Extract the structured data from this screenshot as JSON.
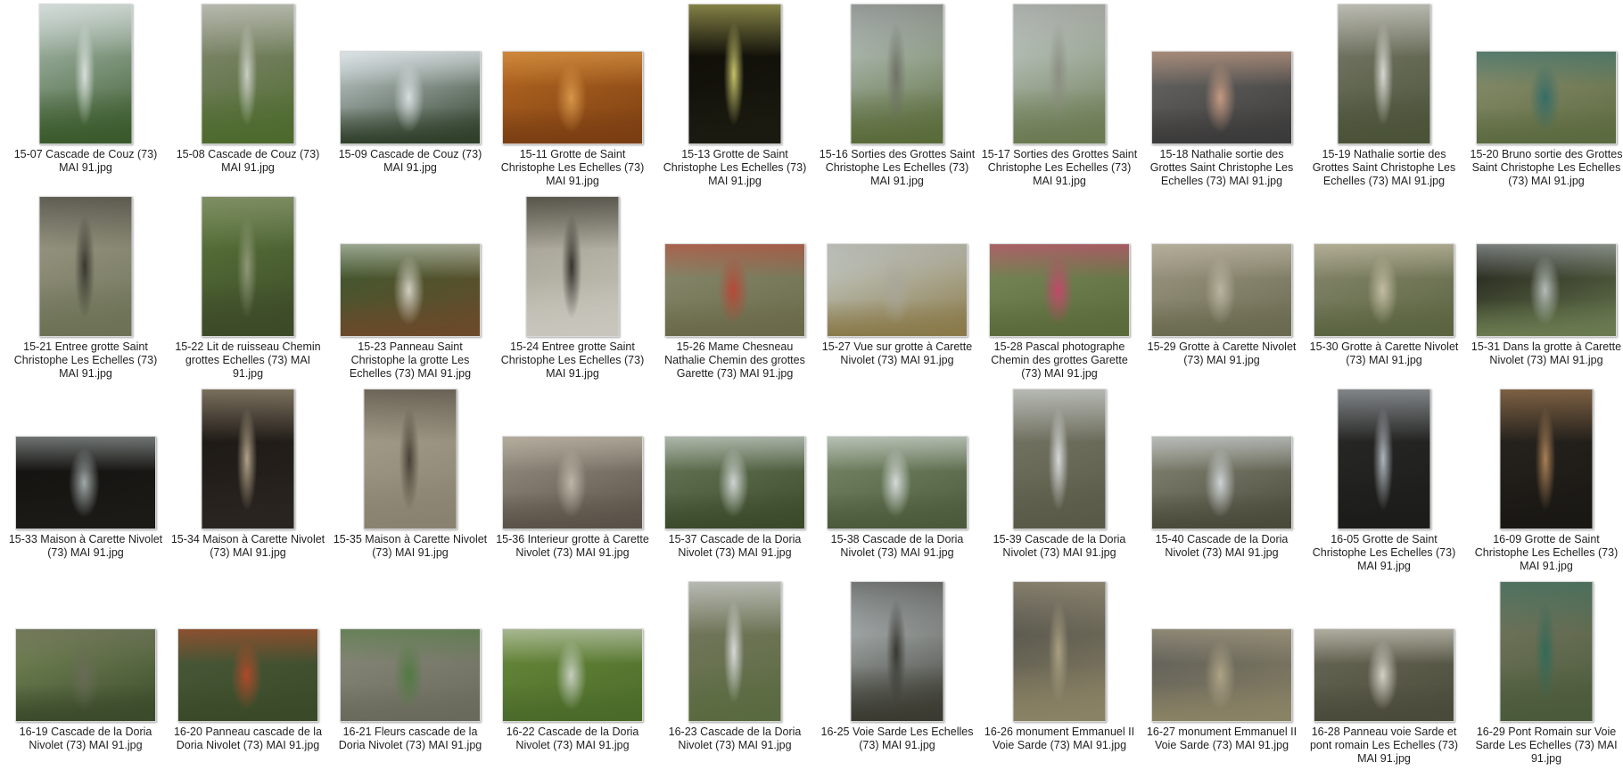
{
  "files": [
    {
      "name": "15-07 Cascade de Couz (73) MAI 91.jpg",
      "orientation": "portrait",
      "colors": [
        "#b7c6bf",
        "#3a5a2c",
        "#e8ecec"
      ]
    },
    {
      "name": "15-08 Cascade de Couz (73) MAI 91.jpg",
      "orientation": "portrait",
      "colors": [
        "#8a8c7a",
        "#4d6a2e",
        "#d9dcd6"
      ]
    },
    {
      "name": "15-09 Cascade de Couz (73) MAI 91.jpg",
      "orientation": "landscape",
      "colors": [
        "#c9d3d6",
        "#2f3f2a",
        "#e6ecef"
      ]
    },
    {
      "name": "15-11 Grotte de Saint Christophe Les Echelles (73) MAI 91.jpg",
      "orientation": "landscape",
      "colors": [
        "#b86a22",
        "#7a3e12",
        "#e0a050"
      ]
    },
    {
      "name": "15-13 Grotte de Saint Christophe Les Echelles (73) MAI 91.jpg",
      "orientation": "portrait",
      "colors": [
        "#0c0a05",
        "#1a1a10",
        "#e5e27a"
      ]
    },
    {
      "name": "15-16 Sorties des Grottes Saint Christophe Les Echelles (73) MAI 91.jpg",
      "orientation": "portrait",
      "colors": [
        "#c6d0d4",
        "#5a6b3a",
        "#6a6a62"
      ]
    },
    {
      "name": "15-17 Sorties des Grottes Saint Christophe Les Echelles (73) MAI 91.jpg",
      "orientation": "portrait",
      "colors": [
        "#cdd5d8",
        "#6b7a52",
        "#8a8a80"
      ]
    },
    {
      "name": "15-18 Nathalie sortie des Grottes Saint Christophe Les Echelles (73) MAI 91.jpg",
      "orientation": "landscape",
      "colors": [
        "#6b6a66",
        "#3b3a3a",
        "#d8a58a"
      ]
    },
    {
      "name": "15-19 Nathalie sortie des Grottes Saint Christophe Les Echelles (73) MAI 91.jpg",
      "orientation": "portrait",
      "colors": [
        "#7d7e6e",
        "#4a5238",
        "#ecebe8"
      ]
    },
    {
      "name": "15-20 Bruno sortie des Grottes Saint Christophe Les Echelles (73) MAI 91.jpg",
      "orientation": "landscape",
      "colors": [
        "#8c9070",
        "#5c6a40",
        "#2a6a6a"
      ]
    },
    {
      "name": "15-21 Entree grotte Saint Christophe Les Echelles (73) MAI 91.jpg",
      "orientation": "portrait",
      "colors": [
        "#a29e8e",
        "#6d7256",
        "#2a2a24"
      ]
    },
    {
      "name": "15-22 Lit de ruisseau Chemin grottes Echelles (73) MAI 91.jpg",
      "orientation": "portrait",
      "colors": [
        "#5d7a3c",
        "#3c4a28",
        "#9aa084"
      ]
    },
    {
      "name": "15-23 Panneau Saint Christophe la grotte Les Echelles (73) MAI 91.jpg",
      "orientation": "landscape",
      "colors": [
        "#3a5a30",
        "#6a4a2a",
        "#e8e4dc"
      ]
    },
    {
      "name": "15-24 Entree grotte Saint Christophe Les Echelles (73) MAI 91.jpg",
      "orientation": "portrait",
      "colors": [
        "#9d9a8a",
        "#c8c6bc",
        "#1f1c18"
      ]
    },
    {
      "name": "15-26 Mame Chesneau Nathalie Chemin des grottes Garette (73) MAI 91.jpg",
      "orientation": "landscape",
      "colors": [
        "#8a8c70",
        "#6a6a4a",
        "#c04030"
      ]
    },
    {
      "name": "15-27 Vue sur grotte à Carette Nivolet (73) MAI 91.jpg",
      "orientation": "landscape",
      "colors": [
        "#c8d0d0",
        "#8a7a4a",
        "#a8a69a"
      ]
    },
    {
      "name": "15-28 Pascal photographe Chemin des grottes Garette (73) MAI 91.jpg",
      "orientation": "landscape",
      "colors": [
        "#7a8a5a",
        "#5a6a3a",
        "#d04070"
      ]
    },
    {
      "name": "15-29 Grotte à Carette Nivolet (73) MAI 91.jpg",
      "orientation": "landscape",
      "colors": [
        "#a09a86",
        "#6a6a50",
        "#c2bcaa"
      ]
    },
    {
      "name": "15-30 Grotte à Carette Nivolet (73) MAI 91.jpg",
      "orientation": "landscape",
      "colors": [
        "#8a8a70",
        "#5a6440",
        "#d0c8b0"
      ]
    },
    {
      "name": "15-31 Dans la grotte à Carette Nivolet (73) MAI 91.jpg",
      "orientation": "landscape",
      "colors": [
        "#1a1a16",
        "#6a7a50",
        "#c8d0d0"
      ]
    },
    {
      "name": "15-33 Maison à Carette Nivolet (73) MAI 91.jpg",
      "orientation": "landscape",
      "colors": [
        "#141210",
        "#1c1a16",
        "#b8c4c4"
      ]
    },
    {
      "name": "15-34 Maison à Carette Nivolet (73) MAI 91.jpg",
      "orientation": "portrait",
      "colors": [
        "#1a1612",
        "#2a2420",
        "#c8b89a"
      ]
    },
    {
      "name": "15-35 Maison à Carette Nivolet (73) MAI 91.jpg",
      "orientation": "portrait",
      "colors": [
        "#aaa290",
        "#8a8270",
        "#3a3228"
      ]
    },
    {
      "name": "15-36 Interieur grotte à Carette Nivolet (73) MAI 91.jpg",
      "orientation": "landscape",
      "colors": [
        "#9a9284",
        "#5a5248",
        "#c8c0b0"
      ]
    },
    {
      "name": "15-37 Cascade de la Doria Nivolet (73) MAI 91.jpg",
      "orientation": "landscape",
      "colors": [
        "#6a7a5a",
        "#3a4a2a",
        "#e4e8ec"
      ]
    },
    {
      "name": "15-38 Cascade de la Doria Nivolet (73) MAI 91.jpg",
      "orientation": "landscape",
      "colors": [
        "#7a8a6a",
        "#4a5a3a",
        "#e8ecf0"
      ]
    },
    {
      "name": "15-39 Cascade de la Doria Nivolet (73) MAI 91.jpg",
      "orientation": "portrait",
      "colors": [
        "#7a7a6a",
        "#5a5a48",
        "#e8ecf0"
      ]
    },
    {
      "name": "15-40 Cascade de la Doria Nivolet (73) MAI 91.jpg",
      "orientation": "landscape",
      "colors": [
        "#8a8a7a",
        "#4a4a3a",
        "#dde4ea"
      ]
    },
    {
      "name": "16-05 Grotte de Saint Christophe Les Echelles (73) MAI 91.jpg",
      "orientation": "portrait",
      "colors": [
        "#2a2a28",
        "#1c1c1a",
        "#c8d0d8"
      ]
    },
    {
      "name": "16-09 Grotte de Saint Christophe Les Echelles (73) MAI 91.jpg",
      "orientation": "portrait",
      "colors": [
        "#2a2620",
        "#1a1814",
        "#c09060"
      ]
    },
    {
      "name": "16-19 Cascade de la Doria Nivolet (73) MAI 91.jpg",
      "orientation": "landscape",
      "colors": [
        "#7a8a5a",
        "#3a4a2a",
        "#6a6a5a"
      ]
    },
    {
      "name": "16-20 Panneau cascade de la Doria Nivolet (73) MAI 91.jpg",
      "orientation": "landscape",
      "colors": [
        "#4a5a3a",
        "#3a4a28",
        "#c04828"
      ]
    },
    {
      "name": "16-21 Fleurs cascade de la Doria Nivolet (73) MAI 91.jpg",
      "orientation": "landscape",
      "colors": [
        "#8a8a7c",
        "#6a6a5c",
        "#4a7a3a"
      ]
    },
    {
      "name": "16-22 Cascade de la Doria Nivolet (73) MAI 91.jpg",
      "orientation": "landscape",
      "colors": [
        "#6a8a3a",
        "#4a6a2a",
        "#d8dcd8"
      ]
    },
    {
      "name": "16-23 Cascade de la Doria Nivolet (73) MAI 91.jpg",
      "orientation": "portrait",
      "colors": [
        "#7a7a64",
        "#5a6a40",
        "#e8ecf0"
      ]
    },
    {
      "name": "16-25 Voie Sarde Les Echelles (73) MAI 91.jpg",
      "orientation": "portrait",
      "colors": [
        "#c8d0d4",
        "#3a3a30",
        "#2a2a24"
      ]
    },
    {
      "name": "16-26 monument Emmanuel II Voie Sarde (73) MAI 91.jpg",
      "orientation": "portrait",
      "colors": [
        "#4a4a48",
        "#8a8264",
        "#b4a888"
      ]
    },
    {
      "name": "16-27 monument Emmanuel II Voie Sarde (73) MAI 91.jpg",
      "orientation": "landscape",
      "colors": [
        "#5a5a58",
        "#8a8264",
        "#b8ac8c"
      ]
    },
    {
      "name": "16-28 Panneau voie Sarde et pont romain Les Echelles (73) MAI 91.jpg",
      "orientation": "landscape",
      "colors": [
        "#6a6a58",
        "#4a4a3a",
        "#e8e4da"
      ]
    },
    {
      "name": "16-29 Pont Romain sur Voie Sarde Les Echelles (73) MAI 91.jpg",
      "orientation": "portrait",
      "colors": [
        "#7a7a64",
        "#4a5a3a",
        "#2a6a5a"
      ]
    }
  ]
}
